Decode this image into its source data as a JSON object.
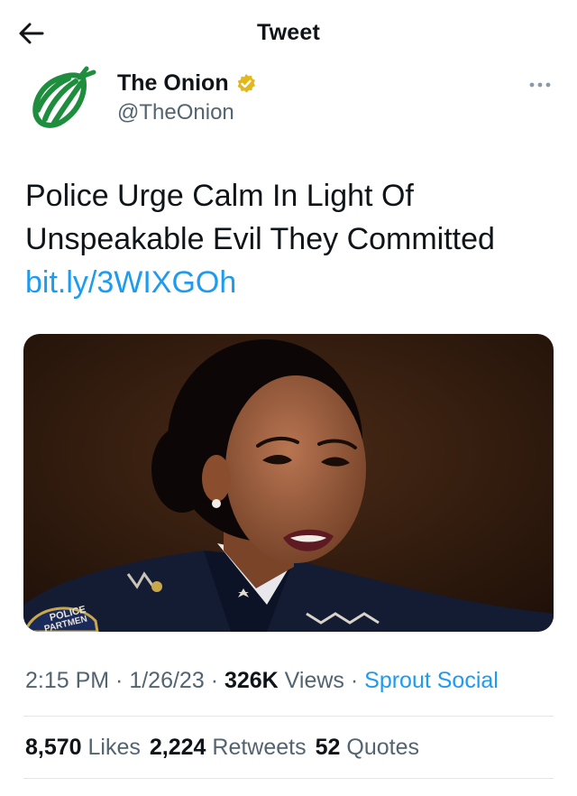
{
  "header": {
    "title": "Tweet",
    "back_icon": "arrow-left-icon"
  },
  "author": {
    "name": "The Onion",
    "handle": "@TheOnion",
    "avatar_icon": "onion-logo-icon",
    "verified_icon": "verified-badge-icon",
    "verified_color": "#e2b719",
    "brand_color": "#1e8e3e"
  },
  "more_icon": "more-dots-icon",
  "tweet": {
    "text_line_1": "Police Urge Calm In Light Of",
    "text_line_2": "Unspeakable Evil They Committed",
    "link": "bit.ly/3WIXGOh"
  },
  "media": {
    "badge_line_1": "POLICE",
    "badge_line_2": "PARTMEN"
  },
  "meta": {
    "time": "2:15 PM",
    "sep1": " · ",
    "date": "1/26/23",
    "sep2": " · ",
    "views_count": "326K",
    "views_label": " Views",
    "sep3": " · ",
    "source": "Sprout Social"
  },
  "stats": {
    "likes_count": "8,570",
    "likes_label": " Likes",
    "retweets_count": "2,224",
    "retweets_label": " Retweets",
    "quotes_count": "52",
    "quotes_label": " Quotes"
  },
  "colors": {
    "link": "#1d9bf0",
    "secondary_text": "#536471",
    "primary_text": "#0f1419"
  }
}
